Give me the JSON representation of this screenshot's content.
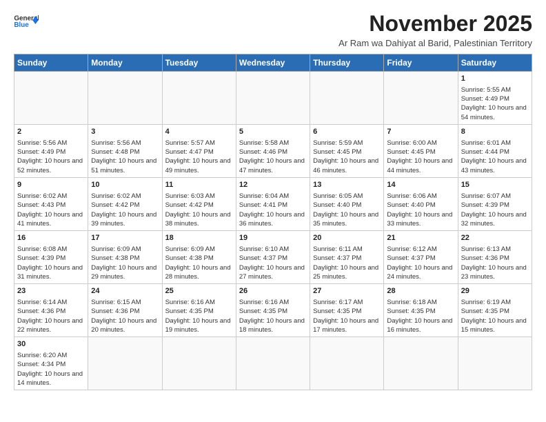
{
  "header": {
    "logo_general": "General",
    "logo_blue": "Blue",
    "month_title": "November 2025",
    "subtitle": "Ar Ram wa Dahiyat al Barid, Palestinian Territory"
  },
  "weekdays": [
    "Sunday",
    "Monday",
    "Tuesday",
    "Wednesday",
    "Thursday",
    "Friday",
    "Saturday"
  ],
  "weeks": [
    [
      {
        "day": "",
        "info": ""
      },
      {
        "day": "",
        "info": ""
      },
      {
        "day": "",
        "info": ""
      },
      {
        "day": "",
        "info": ""
      },
      {
        "day": "",
        "info": ""
      },
      {
        "day": "",
        "info": ""
      },
      {
        "day": "1",
        "info": "Sunrise: 5:55 AM\nSunset: 4:49 PM\nDaylight: 10 hours\nand 54 minutes."
      }
    ],
    [
      {
        "day": "2",
        "info": "Sunrise: 5:56 AM\nSunset: 4:49 PM\nDaylight: 10 hours\nand 52 minutes."
      },
      {
        "day": "3",
        "info": "Sunrise: 5:56 AM\nSunset: 4:48 PM\nDaylight: 10 hours\nand 51 minutes."
      },
      {
        "day": "4",
        "info": "Sunrise: 5:57 AM\nSunset: 4:47 PM\nDaylight: 10 hours\nand 49 minutes."
      },
      {
        "day": "5",
        "info": "Sunrise: 5:58 AM\nSunset: 4:46 PM\nDaylight: 10 hours\nand 47 minutes."
      },
      {
        "day": "6",
        "info": "Sunrise: 5:59 AM\nSunset: 4:45 PM\nDaylight: 10 hours\nand 46 minutes."
      },
      {
        "day": "7",
        "info": "Sunrise: 6:00 AM\nSunset: 4:45 PM\nDaylight: 10 hours\nand 44 minutes."
      },
      {
        "day": "8",
        "info": "Sunrise: 6:01 AM\nSunset: 4:44 PM\nDaylight: 10 hours\nand 43 minutes."
      }
    ],
    [
      {
        "day": "9",
        "info": "Sunrise: 6:02 AM\nSunset: 4:43 PM\nDaylight: 10 hours\nand 41 minutes."
      },
      {
        "day": "10",
        "info": "Sunrise: 6:02 AM\nSunset: 4:42 PM\nDaylight: 10 hours\nand 39 minutes."
      },
      {
        "day": "11",
        "info": "Sunrise: 6:03 AM\nSunset: 4:42 PM\nDaylight: 10 hours\nand 38 minutes."
      },
      {
        "day": "12",
        "info": "Sunrise: 6:04 AM\nSunset: 4:41 PM\nDaylight: 10 hours\nand 36 minutes."
      },
      {
        "day": "13",
        "info": "Sunrise: 6:05 AM\nSunset: 4:40 PM\nDaylight: 10 hours\nand 35 minutes."
      },
      {
        "day": "14",
        "info": "Sunrise: 6:06 AM\nSunset: 4:40 PM\nDaylight: 10 hours\nand 33 minutes."
      },
      {
        "day": "15",
        "info": "Sunrise: 6:07 AM\nSunset: 4:39 PM\nDaylight: 10 hours\nand 32 minutes."
      }
    ],
    [
      {
        "day": "16",
        "info": "Sunrise: 6:08 AM\nSunset: 4:39 PM\nDaylight: 10 hours\nand 31 minutes."
      },
      {
        "day": "17",
        "info": "Sunrise: 6:09 AM\nSunset: 4:38 PM\nDaylight: 10 hours\nand 29 minutes."
      },
      {
        "day": "18",
        "info": "Sunrise: 6:09 AM\nSunset: 4:38 PM\nDaylight: 10 hours\nand 28 minutes."
      },
      {
        "day": "19",
        "info": "Sunrise: 6:10 AM\nSunset: 4:37 PM\nDaylight: 10 hours\nand 27 minutes."
      },
      {
        "day": "20",
        "info": "Sunrise: 6:11 AM\nSunset: 4:37 PM\nDaylight: 10 hours\nand 25 minutes."
      },
      {
        "day": "21",
        "info": "Sunrise: 6:12 AM\nSunset: 4:37 PM\nDaylight: 10 hours\nand 24 minutes."
      },
      {
        "day": "22",
        "info": "Sunrise: 6:13 AM\nSunset: 4:36 PM\nDaylight: 10 hours\nand 23 minutes."
      }
    ],
    [
      {
        "day": "23",
        "info": "Sunrise: 6:14 AM\nSunset: 4:36 PM\nDaylight: 10 hours\nand 22 minutes."
      },
      {
        "day": "24",
        "info": "Sunrise: 6:15 AM\nSunset: 4:36 PM\nDaylight: 10 hours\nand 20 minutes."
      },
      {
        "day": "25",
        "info": "Sunrise: 6:16 AM\nSunset: 4:35 PM\nDaylight: 10 hours\nand 19 minutes."
      },
      {
        "day": "26",
        "info": "Sunrise: 6:16 AM\nSunset: 4:35 PM\nDaylight: 10 hours\nand 18 minutes."
      },
      {
        "day": "27",
        "info": "Sunrise: 6:17 AM\nSunset: 4:35 PM\nDaylight: 10 hours\nand 17 minutes."
      },
      {
        "day": "28",
        "info": "Sunrise: 6:18 AM\nSunset: 4:35 PM\nDaylight: 10 hours\nand 16 minutes."
      },
      {
        "day": "29",
        "info": "Sunrise: 6:19 AM\nSunset: 4:35 PM\nDaylight: 10 hours\nand 15 minutes."
      }
    ],
    [
      {
        "day": "30",
        "info": "Sunrise: 6:20 AM\nSunset: 4:34 PM\nDaylight: 10 hours\nand 14 minutes."
      },
      {
        "day": "",
        "info": ""
      },
      {
        "day": "",
        "info": ""
      },
      {
        "day": "",
        "info": ""
      },
      {
        "day": "",
        "info": ""
      },
      {
        "day": "",
        "info": ""
      },
      {
        "day": "",
        "info": ""
      }
    ]
  ]
}
